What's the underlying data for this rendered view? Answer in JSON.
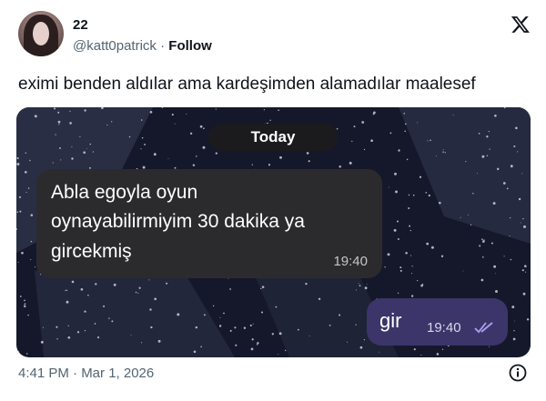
{
  "author": {
    "name": "22",
    "handle": "@katt0patrick",
    "separator": " · ",
    "follow_label": "Follow"
  },
  "tweet": {
    "text": "eximi benden aldılar ama kardeşimden alamadılar maalesef",
    "timestamp": "4:41 PM · Mar 1, 2026"
  },
  "chat": {
    "date_label": "Today",
    "incoming": {
      "lines": [
        "Abla egoyla oyun",
        "oynayabilirmiyim 30 dakika ya",
        "gircekmiş"
      ],
      "time": "19:40"
    },
    "outgoing": {
      "text": "gir",
      "time": "19:40",
      "status": "read"
    }
  },
  "icons": {
    "brand": "x-logo-icon",
    "info": "info-icon",
    "read_receipt": "double-check-icon"
  },
  "colors": {
    "chat_background": "#15182a",
    "incoming_bubble": "#2b2b2e",
    "outgoing_bubble": "#3b3569",
    "secondary_text": "#536471"
  }
}
